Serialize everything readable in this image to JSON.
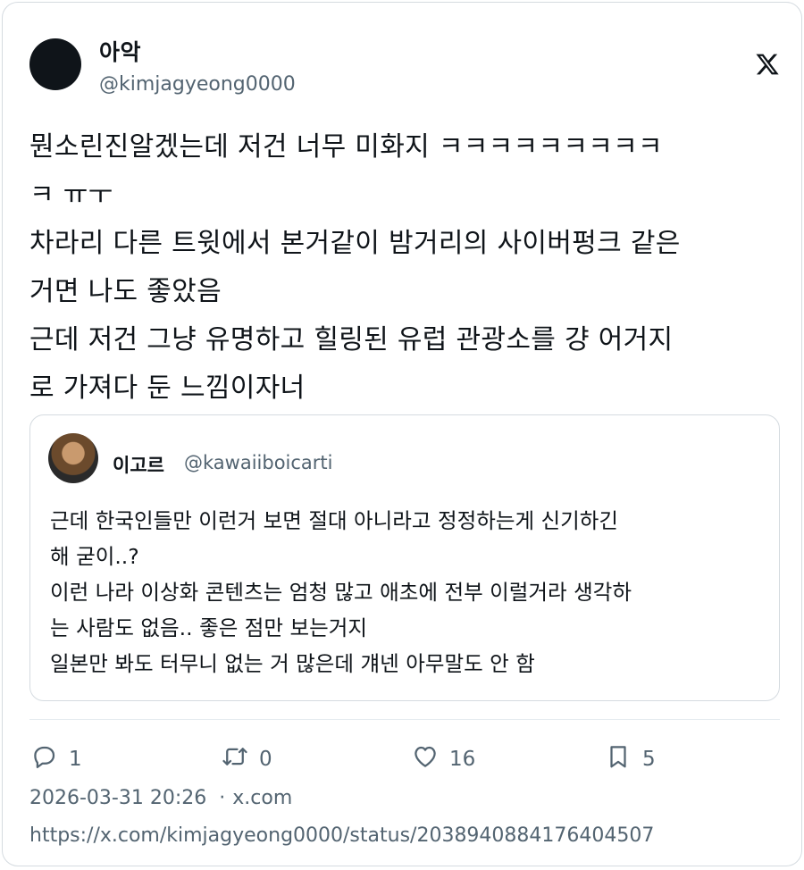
{
  "author": {
    "display_name": "아악",
    "handle": "@kimjagyeong0000"
  },
  "brand_icon": "x-logo-icon",
  "tweet": {
    "text_lines": [
      "뭔소린진알겠는데 저건 너무 미화지 ㅋㅋㅋㅋㅋㅋㅋㅋㅋ",
      "ㅋ ㅠㅜ",
      "차라리 다른 트윗에서 본거같이 밤거리의 사이버펑크 같은",
      "거면 나도 좋았음",
      "근데 저건 그냥 유명하고 힐링된 유럽 관광소를 걍 어거지",
      "로 가져다 둔 느낌이자너"
    ]
  },
  "quoted_tweet": {
    "display_name": "이고르",
    "handle": "@kawaiiboicarti",
    "text_lines": [
      "근데 한국인들만 이런거 보면 절대 아니라고 정정하는게 신기하긴",
      "해 굳이..?",
      "이런 나라 이상화 콘텐츠는 엄청 많고 애초에 전부 이럴거라 생각하",
      "는 사람도 없음.. 좋은 점만 보는거지",
      "일본만 봐도 터무니 없는 거 많은데 걔넨 아무말도 안 함"
    ]
  },
  "actions": {
    "reply": {
      "icon": "reply-icon",
      "count": "1"
    },
    "retweet": {
      "icon": "retweet-icon",
      "count": "0"
    },
    "like": {
      "icon": "heart-icon",
      "count": "16"
    },
    "bookmark": {
      "icon": "bookmark-icon",
      "count": "5"
    }
  },
  "meta": {
    "timestamp": "2026-03-31 20:26",
    "separator": "·",
    "source": "x.com"
  },
  "status_url": "https://x.com/kimjagyeong0000/status/2038940884176404507",
  "colors": {
    "text": "#0f1419",
    "secondary": "#536471",
    "border": "#d5dbe0"
  }
}
